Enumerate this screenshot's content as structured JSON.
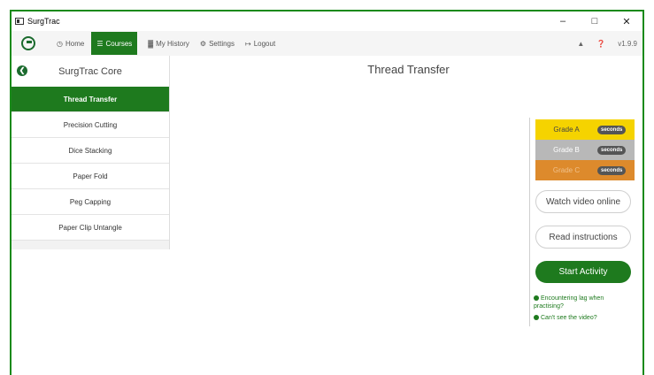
{
  "window": {
    "title": "SurgTrac",
    "minimize": "–",
    "maximize": "□",
    "close": "✕"
  },
  "nav": {
    "items": [
      {
        "icon": "◷",
        "label": "Home"
      },
      {
        "icon": "☰",
        "label": "Courses"
      },
      {
        "icon": "▓",
        "label": "My History"
      },
      {
        "icon": "⚙",
        "label": "Settings"
      },
      {
        "icon": "↦",
        "label": "Logout"
      }
    ],
    "bell_icon": "▲",
    "help_icon": "❓",
    "version": "v1.9.9"
  },
  "sidebar": {
    "title": "SurgTrac Core",
    "items": [
      {
        "label": "Thread Transfer"
      },
      {
        "label": "Precision Cutting"
      },
      {
        "label": "Dice Stacking"
      },
      {
        "label": "Paper Fold"
      },
      {
        "label": "Peg Capping"
      },
      {
        "label": "Paper Clip Untangle"
      }
    ]
  },
  "main": {
    "title": "Thread Transfer",
    "grades": [
      {
        "label": "Grade A",
        "unit": "seconds"
      },
      {
        "label": "Grade B",
        "unit": "seconds"
      },
      {
        "label": "Grade C",
        "unit": "seconds"
      }
    ],
    "watch_label": "Watch video online",
    "read_label": "Read instructions",
    "start_label": "Start Activity",
    "help_lag": "Encountering lag when practising?",
    "help_video": "Can't see the video?"
  },
  "colors": {
    "accent": "#1e7a1e",
    "grade_a": "#f5d300",
    "grade_b": "#b8b8b8",
    "grade_c": "#dd8a2c"
  }
}
